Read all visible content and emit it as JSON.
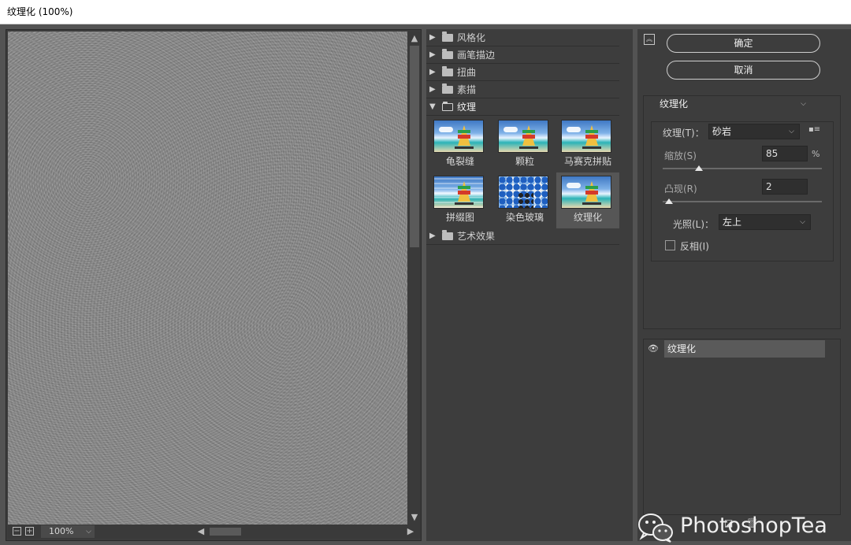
{
  "window": {
    "title": "纹理化 (100%)"
  },
  "preview": {
    "zoom_label": "100%",
    "zoom_out_glyph": "−",
    "zoom_in_glyph": "+",
    "icons": {
      "scroll_up": "triangle-up",
      "scroll_down": "triangle-down",
      "scroll_left": "triangle-left",
      "scroll_right": "triangle-right"
    }
  },
  "filter_list": {
    "categories": [
      {
        "label": "风格化",
        "expanded": false
      },
      {
        "label": "画笔描边",
        "expanded": false
      },
      {
        "label": "扭曲",
        "expanded": false
      },
      {
        "label": "素描",
        "expanded": false
      },
      {
        "label": "纹理",
        "expanded": true
      },
      {
        "label": "艺术效果",
        "expanded": false
      }
    ],
    "texture_filters": [
      {
        "label": "龟裂缝",
        "selected": false
      },
      {
        "label": "颗粒",
        "selected": false
      },
      {
        "label": "马赛克拼贴",
        "selected": false
      },
      {
        "label": "拼缀图",
        "selected": false
      },
      {
        "label": "染色玻璃",
        "selected": false
      },
      {
        "label": "纹理化",
        "selected": true
      }
    ]
  },
  "buttons": {
    "ok": "确定",
    "cancel": "取消"
  },
  "settings": {
    "filter_select": "纹理化",
    "texture_label": "纹理(T)：",
    "texture_value": "砂岩",
    "scale_label": "缩放(S)",
    "scale_value": "85",
    "scale_unit": "%",
    "scale_slider_fraction": 0.23,
    "relief_label": "凸现(R)",
    "relief_value": "2",
    "relief_slider_fraction": 0.04,
    "light_label": "光照(L)：",
    "light_value": "左上",
    "invert_label": "反相(I)",
    "invert_checked": false
  },
  "layers": {
    "items": [
      {
        "name": "纹理化",
        "visible": true
      }
    ]
  },
  "watermark": {
    "text": "PhotoshopTea"
  }
}
